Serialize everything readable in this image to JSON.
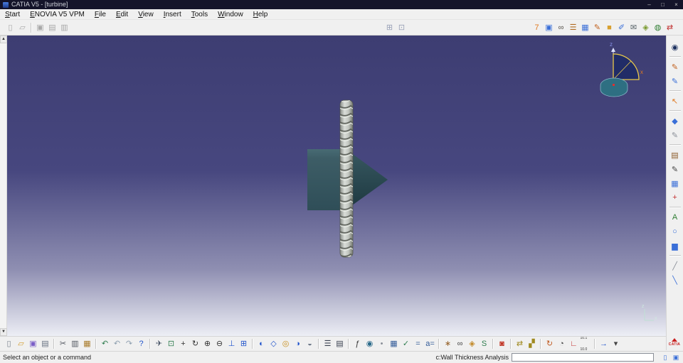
{
  "window": {
    "title": "CATIA V5 - [turbine]",
    "controls": {
      "minimize": "–",
      "maximize": "□",
      "close": "×"
    }
  },
  "menubar": {
    "items": [
      {
        "name": "menu-start",
        "label": "Start"
      },
      {
        "name": "menu-enovia-v5-vpm",
        "label": "ENOVIA V5 VPM"
      },
      {
        "name": "menu-file",
        "label": "File"
      },
      {
        "name": "menu-edit",
        "label": "Edit"
      },
      {
        "name": "menu-view",
        "label": "View"
      },
      {
        "name": "menu-insert",
        "label": "Insert"
      },
      {
        "name": "menu-tools",
        "label": "Tools"
      },
      {
        "name": "menu-window",
        "label": "Window"
      },
      {
        "name": "menu-help",
        "label": "Help"
      }
    ]
  },
  "top_toolbar": {
    "left_icons": [
      {
        "name": "enovia-new-icon",
        "glyph": "▯",
        "color": "#a8a8a8"
      },
      {
        "name": "enovia-open-icon",
        "glyph": "▱",
        "color": "#a8a8a8"
      },
      {
        "sep": true
      },
      {
        "name": "enovia-save-icon",
        "glyph": "▣",
        "color": "#a8a8a8"
      },
      {
        "name": "window-cascade-icon",
        "glyph": "▤",
        "color": "#a8a8a8"
      },
      {
        "name": "window-tile-icon",
        "glyph": "▥",
        "color": "#a8a8a8"
      }
    ],
    "mid_icons": [
      {
        "name": "grid-toggle-icon",
        "glyph": "⊞",
        "color": "#9aa2b8"
      },
      {
        "name": "snap-toggle-icon",
        "glyph": "⊡",
        "color": "#9aa2b8"
      }
    ],
    "right_icons": [
      {
        "name": "versions-icon",
        "glyph": "7",
        "color": "#e07820"
      },
      {
        "name": "open-document-icon",
        "glyph": "▣",
        "color": "#3a6fd8"
      },
      {
        "name": "search-binoculars-icon",
        "glyph": "∞",
        "color": "#55504a"
      },
      {
        "name": "database-icon",
        "glyph": "☰",
        "color": "#b06a20"
      },
      {
        "name": "table-icon",
        "glyph": "▦",
        "color": "#3a6fd8"
      },
      {
        "name": "pencil-edit-icon",
        "glyph": "✎",
        "color": "#c2611e"
      },
      {
        "name": "part-box-icon",
        "glyph": "■",
        "color": "#d8a030"
      },
      {
        "name": "draft-document-icon",
        "glyph": "✐",
        "color": "#3a6fd8"
      },
      {
        "name": "send-mail-icon",
        "glyph": "✉",
        "color": "#556066"
      },
      {
        "name": "paintbrush-icon",
        "glyph": "◈",
        "color": "#7a9a30"
      },
      {
        "name": "globe-icon",
        "glyph": "◍",
        "color": "#2e7d32"
      },
      {
        "name": "transfer-icon",
        "glyph": "⇄",
        "color": "#c23030"
      }
    ]
  },
  "right_sidebar": {
    "icons": [
      {
        "name": "active-workbench-icon",
        "glyph": "◉",
        "color": "#1b2f5e"
      },
      {
        "sep": true
      },
      {
        "name": "sketcher-icon",
        "glyph": "✎",
        "color": "#c2611e"
      },
      {
        "name": "positioned-sketch-icon",
        "glyph": "✎",
        "color": "#3a6fd8"
      },
      {
        "sep": true
      },
      {
        "name": "select-arrow-icon",
        "glyph": "↖",
        "color": "#e07820"
      },
      {
        "sep": true
      },
      {
        "name": "pad-icon",
        "glyph": "◆",
        "color": "#3a6fd8"
      },
      {
        "name": "sketch-analysis-icon",
        "glyph": "✎",
        "color": "#8a8f98"
      },
      {
        "sep": true
      },
      {
        "name": "catalog-browser-icon",
        "glyph": "▤",
        "color": "#8a5a2a"
      },
      {
        "name": "pen-icon",
        "glyph": "✎",
        "color": "#444444"
      },
      {
        "name": "grid-icon",
        "glyph": "▦",
        "color": "#3a6fd8"
      },
      {
        "name": "axis-system-icon",
        "glyph": "+",
        "color": "#c23030"
      },
      {
        "sep": true
      },
      {
        "name": "spell-check-icon",
        "glyph": "A",
        "color": "#2e7d32"
      },
      {
        "name": "annotation-bubble-icon",
        "glyph": "○",
        "color": "#3a6fd8"
      },
      {
        "name": "histogram-icon",
        "glyph": "▆",
        "color": "#3a6fd8"
      },
      {
        "sep": true
      },
      {
        "name": "measure-ruler-icon",
        "glyph": "╱",
        "color": "#8a8f98"
      },
      {
        "name": "measure-line-icon",
        "glyph": "╲",
        "color": "#3a6fd8"
      }
    ],
    "logo_text": "CATIA"
  },
  "bottom_toolbar": {
    "items": [
      {
        "name": "new-document-icon",
        "glyph": "▯",
        "color": "#78818c"
      },
      {
        "name": "open-icon",
        "glyph": "▱",
        "color": "#d29b2a"
      },
      {
        "name": "save-icon",
        "glyph": "▣",
        "color": "#7b5fc7"
      },
      {
        "name": "quick-print-icon",
        "glyph": "▤",
        "color": "#667080"
      },
      {
        "sep": true
      },
      {
        "name": "cut-icon",
        "glyph": "✂",
        "color": "#50555f"
      },
      {
        "name": "copy-icon",
        "glyph": "▥",
        "color": "#50555f"
      },
      {
        "name": "paste-icon",
        "glyph": "▦",
        "color": "#a87a28"
      },
      {
        "sep": true
      },
      {
        "name": "undo-icon",
        "glyph": "↶",
        "color": "#2f7d4f"
      },
      {
        "name": "undo-history-icon",
        "glyph": "↶",
        "color": "#8fa0b0"
      },
      {
        "name": "redo-icon",
        "glyph": "↷",
        "color": "#8fa0b0"
      },
      {
        "name": "whats-this-icon",
        "glyph": "?",
        "color": "#2255cc"
      },
      {
        "sep": true
      },
      {
        "name": "fly-mode-icon",
        "glyph": "✈",
        "color": "#4a5668"
      },
      {
        "name": "fit-all-in-icon",
        "glyph": "⊡",
        "color": "#2f7d4f"
      },
      {
        "name": "pan-icon",
        "glyph": "+",
        "color": "#333333"
      },
      {
        "name": "rotate-icon",
        "glyph": "↻",
        "color": "#333333"
      },
      {
        "name": "zoom-in-icon",
        "glyph": "⊕",
        "color": "#333333"
      },
      {
        "name": "zoom-out-icon",
        "glyph": "⊖",
        "color": "#333333"
      },
      {
        "name": "normal-view-icon",
        "glyph": "⊥",
        "color": "#2255cc"
      },
      {
        "name": "multi-view-icon",
        "glyph": "⊞",
        "color": "#2255cc"
      },
      {
        "sep": true
      },
      {
        "name": "shading-mode-icon",
        "glyph": "◐",
        "color": "#2255cc"
      },
      {
        "name": "wireframe-mode-icon",
        "glyph": "◇",
        "color": "#2255cc"
      },
      {
        "name": "lighting-icon",
        "glyph": "◎",
        "color": "#c89020"
      },
      {
        "name": "hide-show-icon",
        "glyph": "◑",
        "color": "#2255cc"
      },
      {
        "name": "swap-visible-space-icon",
        "glyph": "◒",
        "color": "#6f7a8a"
      },
      {
        "sep": true
      },
      {
        "name": "specification-tree-icon",
        "glyph": "☰",
        "color": "#3a4150"
      },
      {
        "name": "graph-overview-icon",
        "glyph": "▤",
        "color": "#3a4150"
      },
      {
        "sep": true
      },
      {
        "name": "formula-icon",
        "glyph": "ƒ",
        "color": "#333333"
      },
      {
        "name": "knowledge-inspector-icon",
        "glyph": "◉",
        "color": "#2a6a8a"
      },
      {
        "name": "parameters-icon",
        "glyph": "•",
        "color": "#8a8f98"
      },
      {
        "name": "design-table-icon",
        "glyph": "▦",
        "color": "#335c99"
      },
      {
        "name": "check-analysis-icon",
        "glyph": "✓",
        "color": "#2f7d4f"
      },
      {
        "name": "equivalent-dimensions-icon",
        "glyph": "=",
        "color": "#335c99"
      },
      {
        "name": "annotations-icon",
        "glyph": "a=",
        "color": "#335c99"
      },
      {
        "sep": true
      },
      {
        "name": "manipulation-icon",
        "glyph": "∗",
        "color": "#96632a"
      },
      {
        "name": "search-icon",
        "glyph": "∞",
        "color": "#444444"
      },
      {
        "name": "generative-view-icon",
        "glyph": "◈",
        "color": "#c28a2a"
      },
      {
        "name": "surface-icon",
        "glyph": "S",
        "color": "#2f7d4f"
      },
      {
        "sep": true
      },
      {
        "name": "apply-material-icon",
        "glyph": "◙",
        "color": "#c03020"
      },
      {
        "sep": true
      },
      {
        "name": "exchange-icon",
        "glyph": "⇄",
        "color": "#a08a20"
      },
      {
        "name": "split-view-icon",
        "glyph": "▞",
        "color": "#a08a20"
      },
      {
        "sep": true
      },
      {
        "name": "update-icon",
        "glyph": "↻",
        "color": "#c05a20"
      },
      {
        "name": "clock-icon",
        "glyph": "◔",
        "color": "#444444"
      },
      {
        "name": "axis-icon",
        "glyph": "∟",
        "color": "#c23030"
      },
      {
        "name": "scale-values-icon",
        "glyph": "10.1 10.0",
        "color": "#333333"
      },
      {
        "sep": true
      },
      {
        "name": "goto-pointer-icon",
        "glyph": "→",
        "color": "#2255cc"
      },
      {
        "name": "more-tools-icon",
        "glyph": "▾",
        "color": "#444444"
      }
    ]
  },
  "viewport": {
    "scrollbar": {
      "up": "▲",
      "down": "▼"
    },
    "compass": {
      "z_label": "z",
      "x_label": "x"
    },
    "mini_axis": {
      "z_label": "z",
      "x_label": "x"
    }
  },
  "statusbar": {
    "message": "Select an object or a command",
    "field_label": "c:Wall Thickness Analysis",
    "field_value": "",
    "icons": [
      {
        "name": "status-doc-icon",
        "glyph": "▯",
        "color": "#3a6fd8"
      },
      {
        "name": "status-link-icon",
        "glyph": "▣",
        "color": "#3a6fd8"
      }
    ]
  },
  "colors": {
    "titlebar_bg": "#14142a",
    "chrome_bg": "#f0f0f0",
    "viewport_top": "#3d3d72",
    "viewport_mid": "#47477f",
    "viewport_low": "#8f8fb2",
    "viewport_bottom": "#eceef5",
    "model_body": "#3d5d66",
    "model_cone_dark": "#1d363e",
    "screw_light": "#d9ddd9",
    "screw_dark": "#74786f",
    "accent_select": "#e07820"
  }
}
